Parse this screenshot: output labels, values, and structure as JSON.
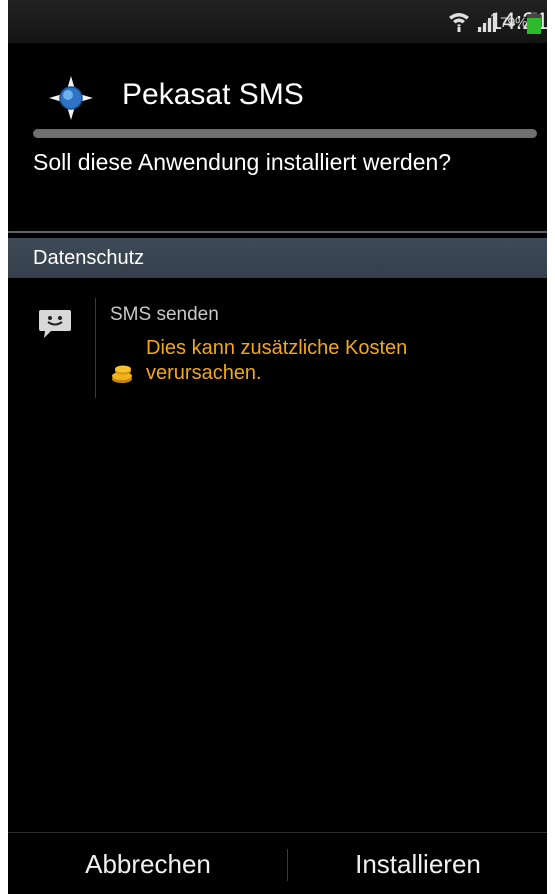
{
  "status_bar": {
    "battery_percent": "79%",
    "time": "14:21",
    "icons": [
      "wifi-icon",
      "signal-icon",
      "battery-icon"
    ],
    "battery_color": "#2dbb2d"
  },
  "dialog": {
    "app_name": "Pekasat SMS",
    "app_icon": "app-compass-icon",
    "question": "Soll diese Anwendung installiert werden?"
  },
  "section": {
    "title": "Datenschutz"
  },
  "permissions": [
    {
      "icon": "sms-message-icon",
      "title": "SMS senden",
      "cost_icon": "coins-icon",
      "warning": "Dies kann zusätzliche Kosten verursachen."
    }
  ],
  "buttons": {
    "cancel": "Abbrechen",
    "install": "Installieren"
  },
  "colors": {
    "warning": "#f2a818",
    "section_bg": "#3a4652",
    "background": "#000000"
  }
}
